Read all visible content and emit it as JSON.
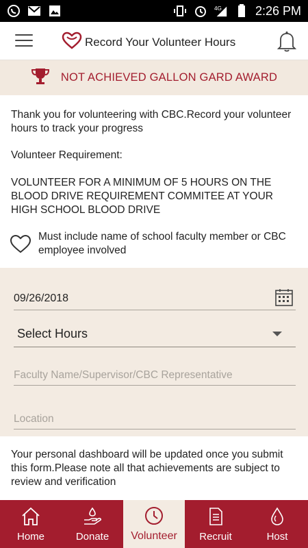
{
  "statusbar": {
    "time": "2:26 PM",
    "icons": [
      "whatsapp-icon",
      "gmail-icon",
      "photo-icon",
      "vibrate-icon",
      "alarm-icon",
      "4g-signal-icon",
      "signal-icon",
      "battery-icon"
    ],
    "network": "4G"
  },
  "appbar": {
    "title": "Record Your Volunteer Hours",
    "menu_icon": "hamburger-icon",
    "logo_icon": "heart-logo-icon",
    "bell_icon": "bell-icon"
  },
  "award": {
    "text": "NOT ACHIEVED GALLON GARD AWARD",
    "icon": "trophy-icon",
    "color": "#a31d2e"
  },
  "intro": "Thank you for volunteering with CBC.Record your volunteer hours to track your progress",
  "requirement": {
    "label": "Volunteer Requirement:",
    "body": "VOLUNTEER FOR A MINIMUM OF 5 HOURS ON THE BLOOD DRIVE REQUIREMENT COMMITEE AT YOUR HIGH SCHOOL BLOOD DRIVE"
  },
  "note": {
    "text": "Must include name of school faculty member or CBC employee involved",
    "icon": "heart-outline-icon"
  },
  "form": {
    "date_value": "09/26/2018",
    "hours_select": "Select Hours",
    "faculty_placeholder": "Faculty Name/Supervisor/CBC Representative",
    "location_placeholder": "Location"
  },
  "dashboard_note": "Your personal dashboard will be updated once you submit this form.Please note all that achievements are subject to review and verification",
  "nav": {
    "items": [
      {
        "label": "Home",
        "icon": "home-icon"
      },
      {
        "label": "Donate",
        "icon": "donate-hand-icon"
      },
      {
        "label": "Volunteer",
        "icon": "clock-icon"
      },
      {
        "label": "Recruit",
        "icon": "document-icon"
      },
      {
        "label": "Host",
        "icon": "drops-icon"
      }
    ],
    "active": "Volunteer"
  },
  "colors": {
    "brand": "#a31d2e",
    "cream": "#f3ebe2"
  }
}
